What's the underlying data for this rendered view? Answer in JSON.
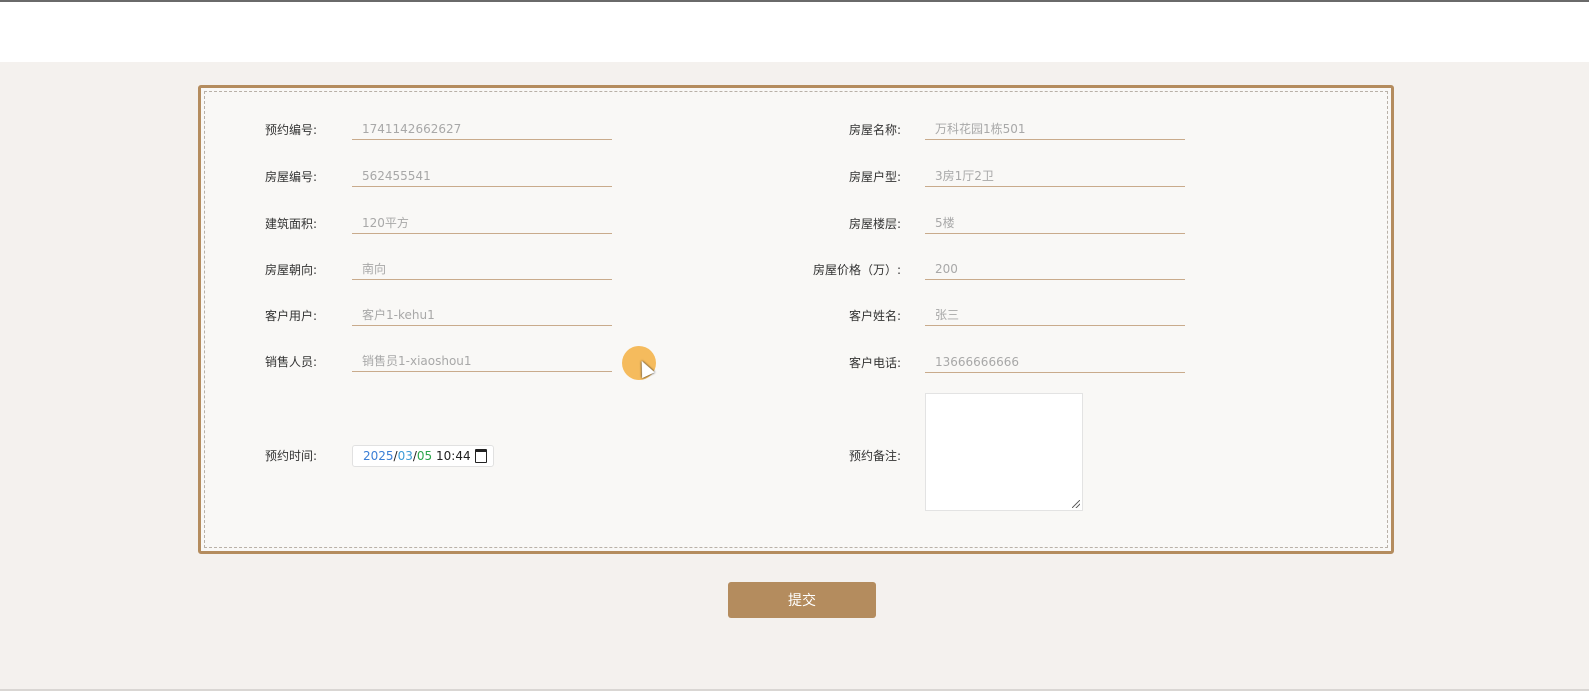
{
  "form": {
    "fields": [
      {
        "label": "预约编号:",
        "value": "1741142662627"
      },
      {
        "label": "房屋名称:",
        "value": "万科花园1栋501"
      },
      {
        "label": "房屋编号:",
        "value": "562455541"
      },
      {
        "label": "房屋户型:",
        "value": "3房1厅2卫"
      },
      {
        "label": "建筑面积:",
        "value": "120平方"
      },
      {
        "label": "房屋楼层:",
        "value": "5楼"
      },
      {
        "label": "房屋朝向:",
        "value": "南向"
      },
      {
        "label": "房屋价格（万）:",
        "value": "200"
      },
      {
        "label": "客户用户:",
        "value": "客户1-kehu1"
      },
      {
        "label": "客户姓名:",
        "value": "张三"
      },
      {
        "label": "销售人员:",
        "value": "销售员1-xiaoshou1"
      },
      {
        "label": "客户电话:",
        "value": "13666666666"
      }
    ],
    "appointment_time": {
      "label": "预约时间:",
      "year": "2025",
      "month": "03",
      "day": "05",
      "sep": "/",
      "time": "10:44"
    },
    "remarks": {
      "label": "预约备注:",
      "value": ""
    }
  },
  "submit_label": "提交",
  "colors": {
    "accent": "#b48c5e",
    "background": "#f4f1ee",
    "form_bg": "#f9f8f6"
  }
}
